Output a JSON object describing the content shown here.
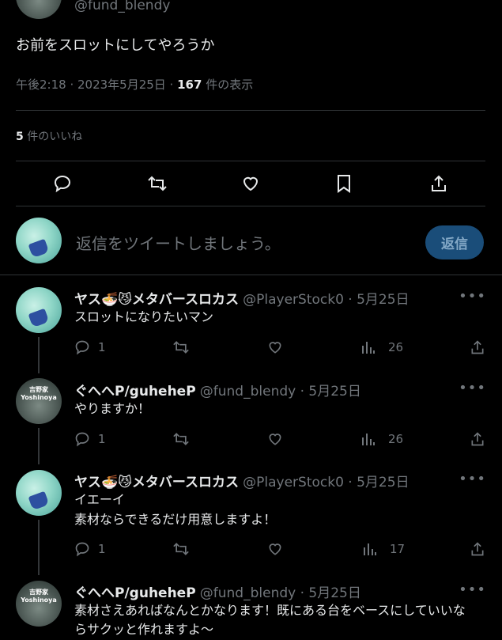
{
  "main_tweet": {
    "handle": "@fund_blendy",
    "text": "お前をスロットにしてやろうか",
    "time": "午後2:18 · 2023年5月25日 · ",
    "views_count": "167",
    "views_label": " 件の表示",
    "likes_count": "5",
    "likes_label": " 件のいいね"
  },
  "compose": {
    "placeholder": "返信をツイートしましょう。",
    "button": "返信"
  },
  "replies": [
    {
      "name": "ヤス🍜😼メタバースロカス",
      "handle": "@PlayerStock0 · 5月25日",
      "lines": [
        "スロットになりたいマン"
      ],
      "reply_count": "1",
      "views": "26"
    },
    {
      "name": "ぐへへP/guheheP",
      "handle": "@fund_blendy · 5月25日",
      "avatar_text": "吉野家 Yoshinoya",
      "lines": [
        "やりますか！"
      ],
      "reply_count": "1",
      "views": "26"
    },
    {
      "name": "ヤス🍜😼メタバースロカス",
      "handle": "@PlayerStock0 · 5月25日",
      "lines": [
        "イエーイ",
        "素材ならできるだけ用意しますよ！"
      ],
      "reply_count": "1",
      "views": "17"
    },
    {
      "name": "ぐへへP/guheheP",
      "handle": "@fund_blendy · 5月25日",
      "avatar_text": "吉野家 Yoshinoya",
      "lines": [
        "素材さえあればなんとかなります！既にある台をベースにしていいな",
        "らサクッと作れますよ〜"
      ]
    }
  ],
  "more": "•••",
  "icons": [
    "reply-icon",
    "retweet-icon",
    "like-icon",
    "bookmark-icon",
    "share-icon",
    "views-icon"
  ]
}
